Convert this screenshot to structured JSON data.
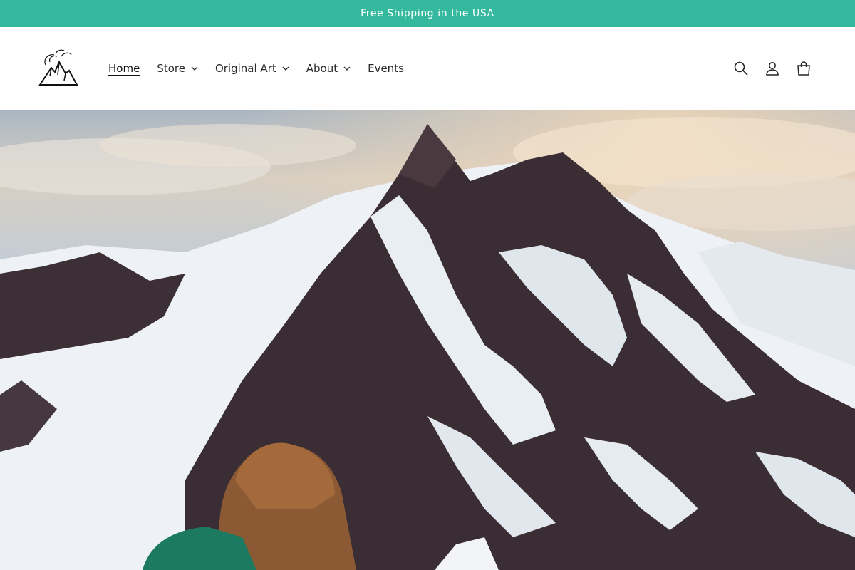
{
  "announcement": {
    "text": "Free Shipping in the USA"
  },
  "header": {
    "logo_icon": "mountain-logo-icon",
    "nav": [
      {
        "label": "Home",
        "active": true,
        "has_dropdown": false
      },
      {
        "label": "Store",
        "active": false,
        "has_dropdown": true
      },
      {
        "label": "Original Art",
        "active": false,
        "has_dropdown": true
      },
      {
        "label": "About",
        "active": false,
        "has_dropdown": true
      },
      {
        "label": "Events",
        "active": false,
        "has_dropdown": false
      }
    ],
    "icons": [
      "search-icon",
      "account-icon",
      "cart-icon"
    ]
  },
  "theme": {
    "accent": "#34b89e",
    "text": "#121212"
  }
}
